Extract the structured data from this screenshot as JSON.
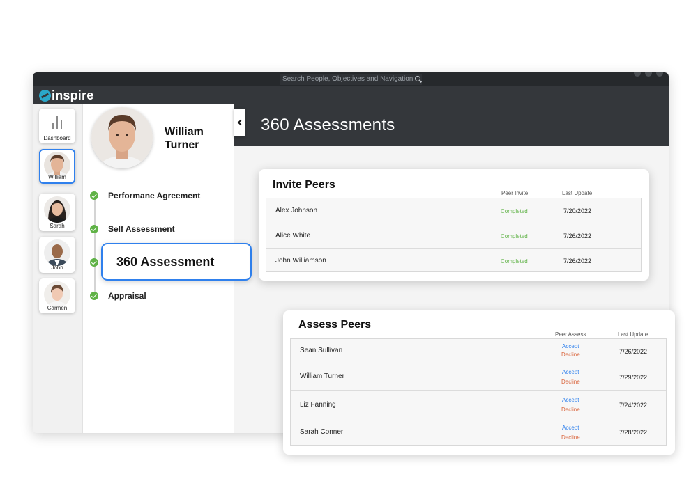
{
  "topbar": {
    "search_placeholder": "Search People, Objectives and Navigation"
  },
  "brand": {
    "name": "inspire"
  },
  "rail": {
    "items": [
      {
        "label": "Dashboard"
      },
      {
        "label": "William",
        "active": true
      },
      {
        "label": "Sarah"
      },
      {
        "label": "John"
      },
      {
        "label": "Carmen"
      }
    ]
  },
  "profile": {
    "first_name": "William",
    "last_name": "Turner",
    "steps": [
      {
        "label": "Performane Agreement"
      },
      {
        "label": "Self Assessment"
      },
      {
        "label": "360 Assessment",
        "current": true
      },
      {
        "label": "Appraisal"
      }
    ]
  },
  "main": {
    "title": "360 Assessments"
  },
  "invite_peers": {
    "title": "Invite Peers",
    "col_status": "Peer Invite",
    "col_date": "Last Update",
    "rows": [
      {
        "name": "Alex Johnson",
        "status": "Completed",
        "date": "7/20/2022"
      },
      {
        "name": "Alice White",
        "status": "Completed",
        "date": "7/26/2022"
      },
      {
        "name": "John Williamson",
        "status": "Completed",
        "date": "7/26/2022"
      }
    ]
  },
  "assess_peers": {
    "title": "Assess Peers",
    "col_status": "Peer Assess",
    "col_date": "Last Update",
    "accept_label": "Accept",
    "decline_label": "Decline",
    "rows": [
      {
        "name": "Sean Sullivan",
        "date": "7/26/2022"
      },
      {
        "name": "William Turner",
        "date": "7/29/2022"
      },
      {
        "name": "Liz Fanning",
        "date": "7/24/2022"
      },
      {
        "name": "Sarah Conner",
        "date": "7/28/2022"
      }
    ]
  },
  "colors": {
    "accent": "#2f80ed",
    "success": "#5fb246",
    "decline": "#d9633a",
    "header": "#34373b"
  }
}
